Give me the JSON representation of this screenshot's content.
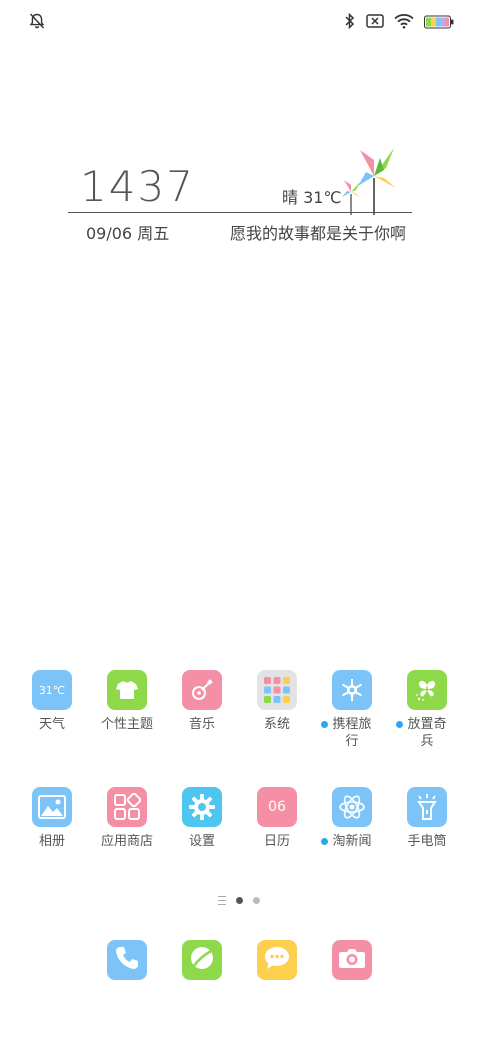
{
  "status_bar": {
    "icons": [
      "bell-off-icon",
      "bluetooth-icon",
      "sim-x-icon",
      "wifi-icon",
      "battery-icon"
    ]
  },
  "widget": {
    "time": "1437",
    "weather": "晴  31℃",
    "date": "09/06 周五",
    "motto": "愿我的故事都是关于你啊"
  },
  "apps_row1": [
    {
      "label": "天气",
      "icon": "weather-icon",
      "icon_text": "31℃",
      "color": "#7cc4f8"
    },
    {
      "label": "个性主题",
      "icon": "tshirt-icon",
      "color": "#8dd94a"
    },
    {
      "label": "音乐",
      "icon": "guitar-icon",
      "color": "#f48fa6"
    },
    {
      "label": "系统",
      "icon": "folder-icon",
      "color": "#e3e3e3"
    },
    {
      "label_line1": "携程旅",
      "label_line2": "行",
      "icon": "snowflake-icon",
      "color": "#7cc4f8",
      "new": true
    },
    {
      "label_line1": "放置奇",
      "label_line2": "兵",
      "icon": "butterfly-icon",
      "color": "#8dd94a",
      "new": true
    }
  ],
  "apps_row2": [
    {
      "label": "相册",
      "icon": "gallery-icon",
      "color": "#7cc4f8"
    },
    {
      "label": "应用商店",
      "icon": "app-store-icon",
      "color": "#f48fa6"
    },
    {
      "label": "设置",
      "icon": "settings-gear-icon",
      "color": "#4dc7f0"
    },
    {
      "label": "日历",
      "icon": "calendar-icon",
      "icon_text": "06",
      "color": "#f48fa6"
    },
    {
      "label": "淘新闻",
      "icon": "atom-icon",
      "color": "#7cc4f8",
      "new": true
    },
    {
      "label": "手电筒",
      "icon": "flashlight-icon",
      "color": "#7cc4f8"
    }
  ],
  "page_indicator": {
    "pages": 2,
    "active": 1
  },
  "dock": [
    {
      "icon": "phone-icon",
      "color": "#7cc4f8"
    },
    {
      "icon": "messages-icon",
      "color": "#8dd94a"
    },
    {
      "icon": "chat-bubble-icon",
      "color": "#fcd04e"
    },
    {
      "icon": "camera-icon",
      "color": "#f48fa6"
    }
  ]
}
